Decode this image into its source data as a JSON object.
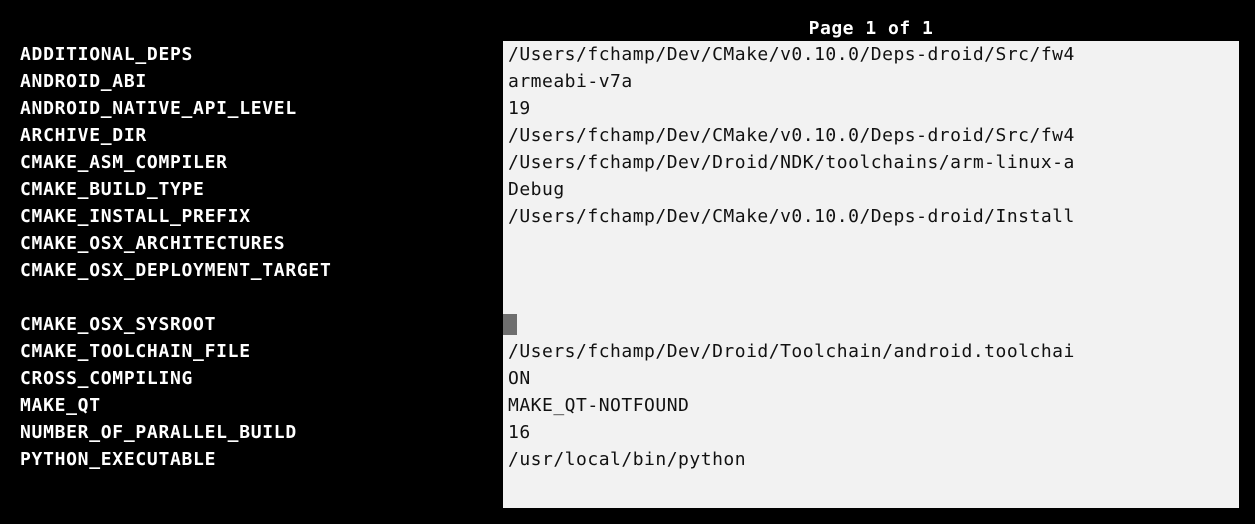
{
  "header": {
    "page_label": "Page 1 of 1"
  },
  "colors": {
    "background": "#000000",
    "panel": "#f2f2f2",
    "name_text": "#ffffff",
    "value_text": "#111111",
    "cursor": "#6e6e6e"
  },
  "entries": [
    {
      "name": "ADDITIONAL_DEPS",
      "value": "/Users/fchamp/Dev/CMake/v0.10.0/Deps-droid/Src/fw4"
    },
    {
      "name": "ANDROID_ABI",
      "value": "armeabi-v7a"
    },
    {
      "name": "ANDROID_NATIVE_API_LEVEL",
      "value": "19"
    },
    {
      "name": "ARCHIVE_DIR",
      "value": "/Users/fchamp/Dev/CMake/v0.10.0/Deps-droid/Src/fw4"
    },
    {
      "name": "CMAKE_ASM_COMPILER",
      "value": "/Users/fchamp/Dev/Droid/NDK/toolchains/arm-linux-a"
    },
    {
      "name": "CMAKE_BUILD_TYPE",
      "value": "Debug"
    },
    {
      "name": "CMAKE_INSTALL_PREFIX",
      "value": "/Users/fchamp/Dev/CMake/v0.10.0/Deps-droid/Install"
    },
    {
      "name": "CMAKE_OSX_ARCHITECTURES",
      "value": ""
    },
    {
      "name": "CMAKE_OSX_DEPLOYMENT_TARGET",
      "value": ""
    },
    {
      "name": "CMAKE_OSX_SYSROOT",
      "value": ""
    },
    {
      "name": "CMAKE_TOOLCHAIN_FILE",
      "value": "/Users/fchamp/Dev/Droid/Toolchain/android.toolchai"
    },
    {
      "name": "CROSS_COMPILING",
      "value": "ON"
    },
    {
      "name": "MAKE_QT",
      "value": "MAKE_QT-NOTFOUND"
    },
    {
      "name": "NUMBER_OF_PARALLEL_BUILD",
      "value": "16"
    },
    {
      "name": "PYTHON_EXECUTABLE",
      "value": "/usr/local/bin/python"
    }
  ]
}
